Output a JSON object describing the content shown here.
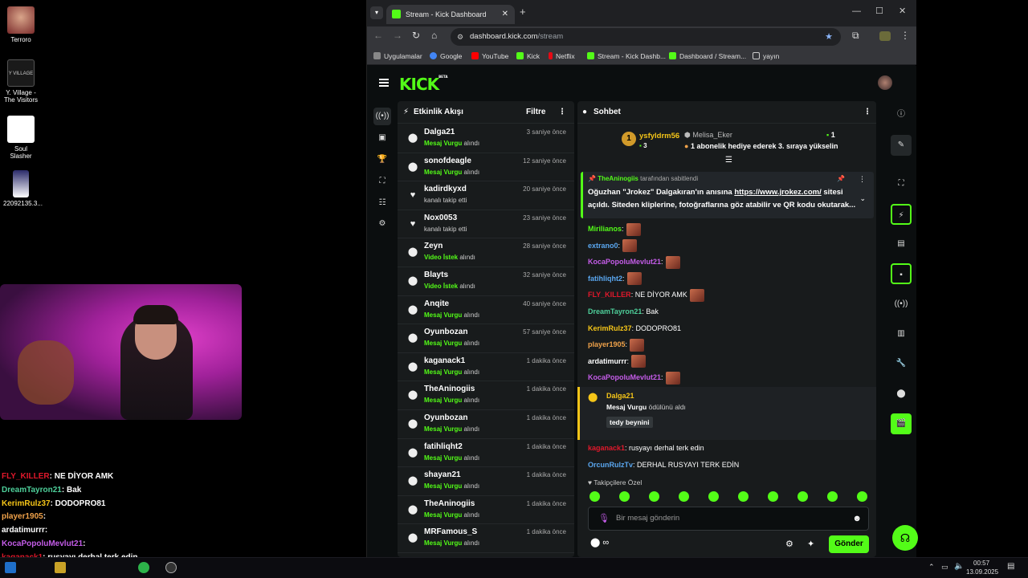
{
  "desktop": {
    "icons": [
      {
        "label": "Terroro"
      },
      {
        "label": "Y. Village - The Visitors"
      },
      {
        "label": "Soul Slasher"
      },
      {
        "label": "22092135.3..."
      }
    ],
    "overlay_chat": [
      {
        "user": "FLY_KILLER",
        "text": ": NE DİYOR AMK",
        "color": "#e0182b"
      },
      {
        "user": "DreamTayron21",
        "text": ": Bak",
        "color": "#4ecf9a"
      },
      {
        "user": "KerimRulz37",
        "text": ": DODOPRO81",
        "color": "#f5c518"
      },
      {
        "user": "player1905",
        "text": ":",
        "color": "#f0a24a"
      },
      {
        "user": "ardatimurrr",
        "text": ":",
        "color": "#ffffff"
      },
      {
        "user": "KocaPopoluMevlut21",
        "text": ":",
        "color": "#c45ce8"
      },
      {
        "user": "kaganack1",
        "text": ": rusyayı derhal terk edin",
        "color": "#e0182b"
      },
      {
        "user": "OrcunRulzTv",
        "text": ": DERHAL RUSYAYI TERK EDİN",
        "color": "#5aa7f0"
      }
    ]
  },
  "taskbar": {
    "time": "00:57",
    "date": "13.09.2025"
  },
  "browser": {
    "tab_title": "Stream - Kick Dashboard",
    "url_host": "dashboard.kick.com",
    "url_path": "/stream",
    "bookmarks": [
      "Uygulamalar",
      "Google",
      "YouTube",
      "Kick",
      "Netflix",
      "Stream - Kick Dashb...",
      "Dashboard / Stream...",
      "yayın"
    ]
  },
  "kick": {
    "logo": "KICK",
    "logo_badge": "BETA",
    "activity": {
      "title": "Etkinlik Akışı",
      "filter": "Filtre",
      "rows": [
        {
          "name": "Dalga21",
          "time": "3 saniye önce",
          "hl": "Mesaj Vurgu",
          "rest": " alındı",
          "icon": "⬤"
        },
        {
          "name": "sonofdeagle",
          "time": "12 saniye önce",
          "hl": "Mesaj Vurgu",
          "rest": " alındı",
          "icon": "⬤"
        },
        {
          "name": "kadirdkyxd",
          "time": "20 saniye önce",
          "hl": "",
          "rest": "kanalı takip etti",
          "icon": "♥"
        },
        {
          "name": "Nox0053",
          "time": "23 saniye önce",
          "hl": "",
          "rest": "kanalı takip etti",
          "icon": "♥"
        },
        {
          "name": "Zeyn",
          "time": "28 saniye önce",
          "hl": "Video İstek",
          "rest": " alındı",
          "icon": "⬤"
        },
        {
          "name": "Blayts",
          "time": "32 saniye önce",
          "hl": "Video İstek",
          "rest": " alındı",
          "icon": "⬤"
        },
        {
          "name": "Anqite",
          "time": "40 saniye önce",
          "hl": "Mesaj Vurgu",
          "rest": " alındı",
          "icon": "⬤"
        },
        {
          "name": "Oyunbozan",
          "time": "57 saniye önce",
          "hl": "Mesaj Vurgu",
          "rest": " alındı",
          "icon": "⬤"
        },
        {
          "name": "kaganack1",
          "time": "1 dakika önce",
          "hl": "Mesaj Vurgu",
          "rest": " alındı",
          "icon": "⬤"
        },
        {
          "name": "TheAninogiis",
          "time": "1 dakika önce",
          "hl": "Mesaj Vurgu",
          "rest": " alındı",
          "icon": "⬤"
        },
        {
          "name": "Oyunbozan",
          "time": "1 dakika önce",
          "hl": "Mesaj Vurgu",
          "rest": " alındı",
          "icon": "⬤"
        },
        {
          "name": "fatihliqht2",
          "time": "1 dakika önce",
          "hl": "Mesaj Vurgu",
          "rest": " alındı",
          "icon": "⬤"
        },
        {
          "name": "shayan21",
          "time": "1 dakika önce",
          "hl": "Mesaj Vurgu",
          "rest": " alındı",
          "icon": "⬤"
        },
        {
          "name": "TheAninogiis",
          "time": "1 dakika önce",
          "hl": "Mesaj Vurgu",
          "rest": " alındı",
          "icon": "⬤"
        },
        {
          "name": "MRFamous_S",
          "time": "1 dakika önce",
          "hl": "Mesaj Vurgu",
          "rest": " alındı",
          "icon": "⬤"
        }
      ]
    },
    "chat": {
      "title": "Sohbet",
      "leader": {
        "rank": "1",
        "user": "ysfyldrm56",
        "count": "3",
        "gifter": "Melisa_Eker",
        "gift_count": "1",
        "gift_text": "1 abonelik hediye ederek 3. sıraya yükselin"
      },
      "pinned": {
        "user": "TheAninogiis",
        "by": "tarafından sabitlendi",
        "text1": "Oğuzhan \"Jrokez\" Dalgakıran'ın anısına ",
        "link": "https://www.jrokez.com/",
        "text2": " sitesi",
        "text3": "açıldı. Siteden kliplerine, fotoğraflarına göz atabilir ve QR kodu okutarak..."
      },
      "messages": [
        {
          "user": "Mirilianos",
          "text": ":",
          "color": "#53fc18"
        },
        {
          "user": "extrano0",
          "text": ":",
          "color": "#5aa7f0"
        },
        {
          "user": "KocaPopoluMevlut21",
          "text": ":",
          "color": "#c45ce8"
        },
        {
          "user": "fatihliqht2",
          "text": ":",
          "color": "#5aa7f0"
        },
        {
          "user": "FLY_KILLER",
          "text": ": NE DİYOR AMK",
          "color": "#e0182b"
        },
        {
          "user": "DreamTayron21",
          "text": ": Bak",
          "color": "#4ecf9a"
        },
        {
          "user": "KerimRulz37",
          "text": ": DODOPRO81",
          "color": "#f5c518"
        },
        {
          "user": "player1905",
          "text": ":",
          "color": "#f0a24a"
        },
        {
          "user": "ardatimurrr",
          "text": ":",
          "color": "#ffffff"
        },
        {
          "user": "KocaPopoluMevlut21",
          "text": ":",
          "color": "#c45ce8"
        }
      ],
      "reward": {
        "user": "Dalga21",
        "hl": "Mesaj Vurgu",
        "rest": " ödülünü aldı",
        "note": "tedy beynini"
      },
      "after": [
        {
          "user": "kaganack1",
          "text": ": rusyayı derhal terk edin",
          "color": "#e0182b"
        },
        {
          "user": "OrcunRulzTv",
          "text": ": DERHAL RUSYAYI TERK EDİN",
          "color": "#5aa7f0"
        }
      ],
      "emote_label": "Takipçilere Özel",
      "placeholder": "Bir mesaj gönderin",
      "send": "Gönder",
      "points": "∞"
    }
  }
}
